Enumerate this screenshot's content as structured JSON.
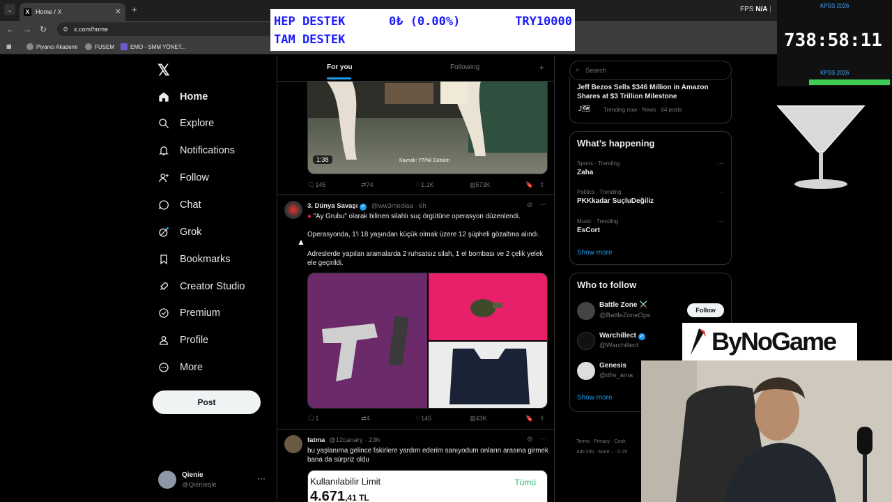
{
  "browser": {
    "tab_title": "Home / X",
    "url": "x.com/home",
    "bookmarks": [
      "Piyancı Akademi",
      "FUSEM",
      "EMO - SMM YÖNET..."
    ]
  },
  "overlays": {
    "ticker_line1_left": "HEP DESTEK",
    "ticker_line1_mid": "0₺ (0.00%)",
    "ticker_line1_right": "TRY10000",
    "ticker_line2": "TAM DESTEK",
    "fps_label": "FPS",
    "fps_value": "N/A",
    "timer_label_top": "KPSS 2026",
    "timer_label_bottom": "KPSS 2026",
    "timer_value": "738:58:11",
    "brand_text": "ByNoGame"
  },
  "nav": {
    "items": [
      {
        "label": "Home",
        "icon": "home-icon"
      },
      {
        "label": "Explore",
        "icon": "search-icon"
      },
      {
        "label": "Notifications",
        "icon": "bell-icon"
      },
      {
        "label": "Follow",
        "icon": "person-add-icon"
      },
      {
        "label": "Chat",
        "icon": "chat-icon"
      },
      {
        "label": "Grok",
        "icon": "grok-icon"
      },
      {
        "label": "Bookmarks",
        "icon": "bookmark-icon"
      },
      {
        "label": "Creator Studio",
        "icon": "rocket-icon"
      },
      {
        "label": "Premium",
        "icon": "premium-icon"
      },
      {
        "label": "Profile",
        "icon": "person-icon"
      },
      {
        "label": "More",
        "icon": "more-circle-icon"
      }
    ],
    "post_label": "Post",
    "account_name": "Qienie",
    "account_handle": "@Qienieqle"
  },
  "feed": {
    "tabs": [
      "For you",
      "Following"
    ],
    "tweet1": {
      "video_duration": "1:38",
      "video_caption": "Kaynak: YT/Nil Gülsüm",
      "replies": "145",
      "reposts": "74",
      "likes": "1.1K",
      "views": "573K"
    },
    "tweet2": {
      "name": "3. Dünya Savaşı",
      "handle": "@ww3mediaa · 6h",
      "line1": "\"Ay Grubu\" olarak bilinen silahlı suç örgütüne operasyon düzenlendi.",
      "line2": "Operasyonda, 1'i 18 yaşından küçük olmak üzere 12 şüpheli gözaltına alındı.",
      "line3": "Adreslerde yapılan aramalarda 2 ruhsatsız silah, 1 el bombası ve 2 çelik yelek ele geçirildi.",
      "replies": "1",
      "reposts": "4",
      "likes": "145",
      "views": "43K"
    },
    "tweet3": {
      "name": "fatma",
      "handle": "@12canary · 23h",
      "text": "bu yaşlanıma gelince fakirlere yardım ederim sanıyodum onların arasına girmek bana da sürpriz oldu",
      "card_label": "Kullanılabilir Limit",
      "card_right": "Tümü",
      "card_value": "4.671",
      "card_cents": ",41 TL"
    }
  },
  "right": {
    "search_placeholder": "Search",
    "news_title": "Jeff Bezos Sells $346 Million in Amazon Shares at $3 Trillion Milestone",
    "news_meta": "Trending now · News · 64 posts",
    "happening_title": "What’s happening",
    "trends": [
      {
        "meta": "Sports · Trending",
        "name": "Zaha"
      },
      {
        "meta": "Politics · Trending",
        "name": "PKKkadar SuçluDeğiliz"
      },
      {
        "meta": "Music · Trending",
        "name": "EsCort"
      }
    ],
    "show_more": "Show more",
    "wtf_title": "Who to follow",
    "wtf": [
      {
        "name": "Battle Zone ⚔️",
        "handle": "@BattleZoneOps"
      },
      {
        "name": "Warchillect",
        "handle": "@Warchillect"
      },
      {
        "name": "Genesis",
        "handle": "@dfw_ama"
      }
    ],
    "follow_label": "Follow",
    "footer_line1": "Terms · Privacy · Cook",
    "footer_line2": "Ads info · More ··· © 20"
  },
  "colors": {
    "accent": "#1d9bf0",
    "background": "#000000",
    "border": "#2f3336",
    "muted": "#71767b"
  }
}
